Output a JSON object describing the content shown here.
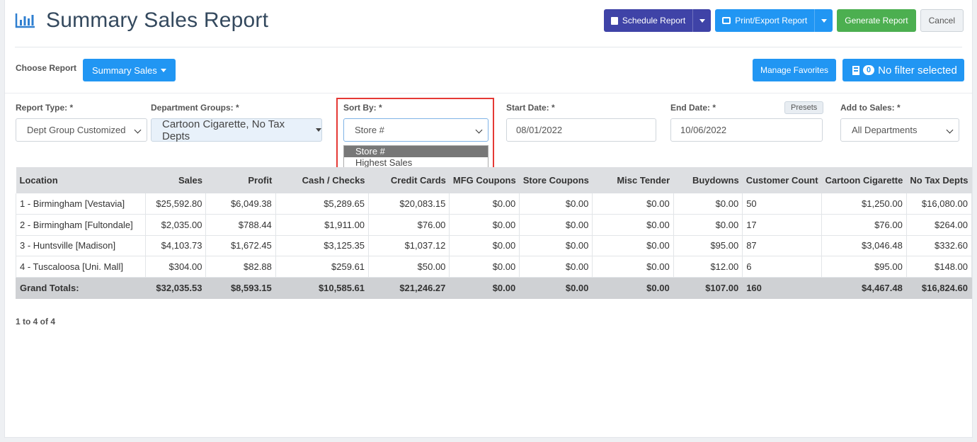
{
  "header": {
    "title": "Summary Sales Report",
    "buttons": {
      "schedule": "Schedule Report",
      "print_export": "Print/Export Report",
      "generate": "Generate Report",
      "cancel": "Cancel"
    }
  },
  "choose_report": {
    "label": "Choose Report",
    "value": "Summary Sales",
    "manage_favorites": "Manage Favorites",
    "filter_count": "0",
    "filter_label": "No filter selected"
  },
  "filters": {
    "report_type": {
      "label": "Report Type: *",
      "value": "Dept Group Customized"
    },
    "department_groups": {
      "label": "Department Groups: *",
      "value": "Cartoon Cigarette, No Tax Depts"
    },
    "sort_by": {
      "label": "Sort By: *",
      "value": "Store #",
      "options": [
        "Store #",
        "Highest Sales"
      ]
    },
    "start_date": {
      "label": "Start Date: *",
      "value": "08/01/2022"
    },
    "end_date": {
      "label": "End Date: *",
      "value": "10/06/2022",
      "presets": "Presets"
    },
    "add_to_sales": {
      "label": "Add to Sales: *",
      "value": "All Departments"
    }
  },
  "table": {
    "columns": [
      "Location",
      "Sales",
      "Profit",
      "Cash / Checks",
      "Credit Cards",
      "MFG Coupons",
      "Store Coupons",
      "Misc Tender",
      "Buydowns",
      "Customer Count",
      "Cartoon Cigarette",
      "No Tax Depts"
    ],
    "rows": [
      [
        "1 - Birmingham [Vestavia]",
        "$25,592.80",
        "$6,049.38",
        "$5,289.65",
        "$20,083.15",
        "$0.00",
        "$0.00",
        "$0.00",
        "$0.00",
        "50",
        "$1,250.00",
        "$16,080.00"
      ],
      [
        "2 - Birmingham [Fultondale]",
        "$2,035.00",
        "$788.44",
        "$1,911.00",
        "$76.00",
        "$0.00",
        "$0.00",
        "$0.00",
        "$0.00",
        "17",
        "$76.00",
        "$264.00"
      ],
      [
        "3 - Huntsville [Madison]",
        "$4,103.73",
        "$1,672.45",
        "$3,125.35",
        "$1,037.12",
        "$0.00",
        "$0.00",
        "$0.00",
        "$95.00",
        "87",
        "$3,046.48",
        "$332.60"
      ],
      [
        "4 - Tuscaloosa [Uni. Mall]",
        "$304.00",
        "$82.88",
        "$259.61",
        "$50.00",
        "$0.00",
        "$0.00",
        "$0.00",
        "$12.00",
        "6",
        "$95.00",
        "$148.00"
      ]
    ],
    "totals": [
      "Grand Totals:",
      "$32,035.53",
      "$8,593.15",
      "$10,585.61",
      "$21,246.27",
      "$0.00",
      "$0.00",
      "$0.00",
      "$107.00",
      "160",
      "$4,467.48",
      "$16,824.60"
    ]
  },
  "pager": "1 to 4 of 4",
  "colors": {
    "accent_blue": "#2196f3",
    "indigo": "#3f43a7",
    "green": "#4caf50",
    "highlight_red": "#e53935"
  },
  "icons": [
    "bar-chart-icon",
    "calendar-icon",
    "printer-icon",
    "building-icon"
  ]
}
